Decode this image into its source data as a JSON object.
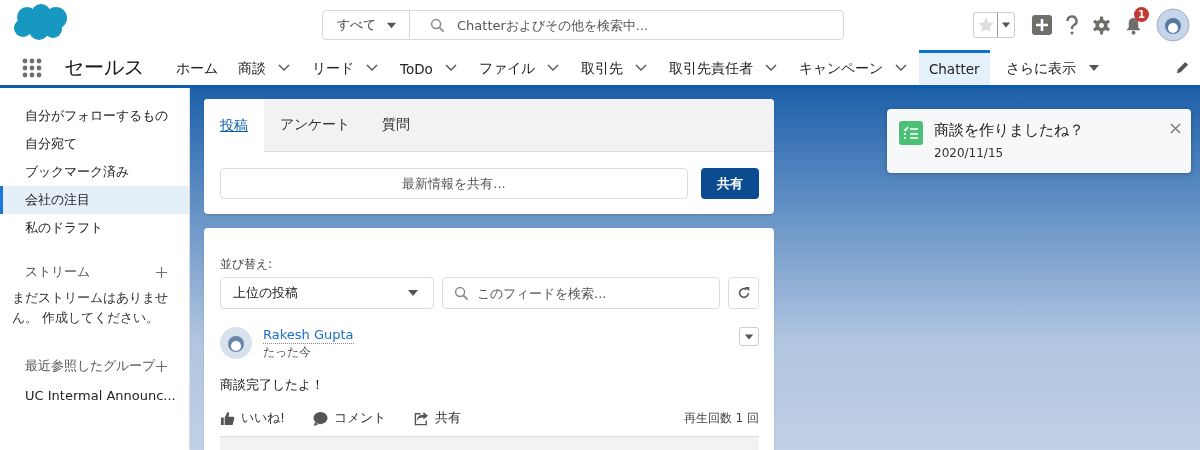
{
  "header": {
    "search": {
      "scope": "すべて",
      "placeholder": "Chatterおよびその他を検索中..."
    },
    "notification_count": "1"
  },
  "nav": {
    "app_name": "セールス",
    "tabs": [
      {
        "label": "ホーム",
        "has_menu": false,
        "selected": false
      },
      {
        "label": "商談",
        "has_menu": true,
        "selected": false
      },
      {
        "label": "リード",
        "has_menu": true,
        "selected": false
      },
      {
        "label": "ToDo",
        "has_menu": true,
        "selected": false
      },
      {
        "label": "ファイル",
        "has_menu": true,
        "selected": false
      },
      {
        "label": "取引先",
        "has_menu": true,
        "selected": false
      },
      {
        "label": "取引先責任者",
        "has_menu": true,
        "selected": false
      },
      {
        "label": "キャンペーン",
        "has_menu": true,
        "selected": false
      },
      {
        "label": "Chatter",
        "has_menu": false,
        "selected": true
      }
    ],
    "more": "さらに表示"
  },
  "sidebar": {
    "items": [
      {
        "label": "自分がフォローするもの",
        "selected": false
      },
      {
        "label": "自分宛て",
        "selected": false
      },
      {
        "label": "ブックマーク済み",
        "selected": false
      },
      {
        "label": "会社の注目",
        "selected": true
      },
      {
        "label": "私のドラフト",
        "selected": false
      }
    ],
    "streams": {
      "title": "ストリーム",
      "empty_text": "まだストリームはありません。 作成してください。"
    },
    "groups": {
      "title": "最近参照したグループ",
      "items": [
        "UC Intermal Announc..."
      ]
    }
  },
  "publisher": {
    "tabs": [
      {
        "label": "投稿",
        "selected": true
      },
      {
        "label": "アンケート",
        "selected": false
      },
      {
        "label": "質問",
        "selected": false
      }
    ],
    "placeholder": "最新情報を共有...",
    "share_button": "共有"
  },
  "feed": {
    "sort_label": "並び替え:",
    "sort_value": "上位の投稿",
    "search_placeholder": "このフィードを検索...",
    "post": {
      "author": "Rakesh Gupta",
      "time": "たった今",
      "body": "商談完了したよ！",
      "actions": [
        {
          "kind": "like",
          "label": "いいね!"
        },
        {
          "kind": "comment",
          "label": "コメント"
        },
        {
          "kind": "share",
          "label": "共有"
        }
      ],
      "views": "再生回数 1 回"
    }
  },
  "toast": {
    "title": "商談を作りましたね？",
    "date": "2020/11/15"
  }
}
